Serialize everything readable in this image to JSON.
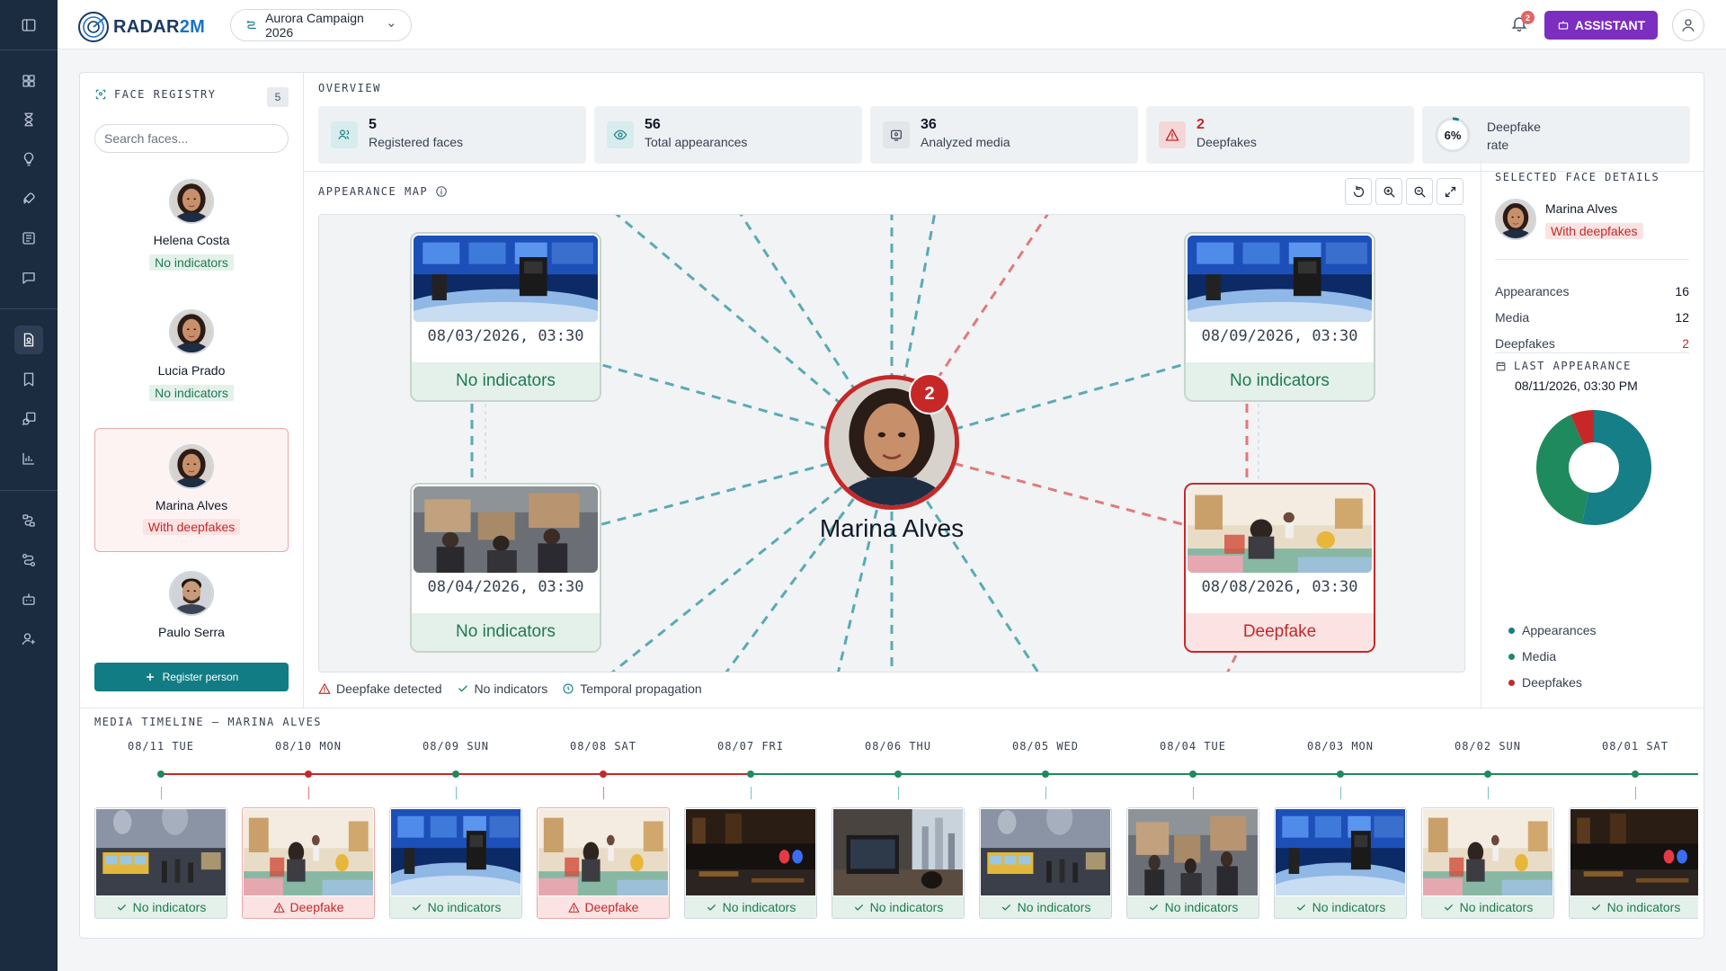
{
  "app": {
    "logo": "RADAR",
    "logo_accent": "2M",
    "campaign": "Aurora Campaign 2026",
    "notifications": "2",
    "assistant_label": "ASSISTANT"
  },
  "registry": {
    "title": "FACE REGISTRY",
    "count": "5",
    "search_placeholder": "Search faces...",
    "faces": [
      {
        "name": "Helena Costa",
        "status": "No indicators"
      },
      {
        "name": "Lucia Prado",
        "status": "No indicators"
      },
      {
        "name": "Marina Alves",
        "status": "With deepfakes"
      },
      {
        "name": "Paulo Serra",
        "status": ""
      }
    ],
    "register_label": "Register person"
  },
  "overview": {
    "title": "OVERVIEW",
    "stats": [
      {
        "value": "5",
        "label": "Registered faces"
      },
      {
        "value": "56",
        "label": "Total appearances"
      },
      {
        "value": "36",
        "label": "Analyzed media"
      },
      {
        "value": "2",
        "label": "Deepfakes"
      },
      {
        "value": "6%",
        "label": "Deepfake rate",
        "fraction": 0.06
      }
    ]
  },
  "map": {
    "title": "APPEARANCE MAP",
    "center_name": "Marina Alves",
    "center_badge": "2",
    "nodes": [
      {
        "date": "08/03/2026, 03:30",
        "status": "No indicators"
      },
      {
        "date": "08/09/2026, 03:30",
        "status": "No indicators"
      },
      {
        "date": "08/04/2026, 03:30",
        "status": "No indicators"
      },
      {
        "date": "08/08/2026, 03:30",
        "status": "Deepfake"
      }
    ],
    "legend": [
      "Deepfake detected",
      "No indicators",
      "Temporal propagation"
    ]
  },
  "details": {
    "title": "SELECTED FACE DETAILS",
    "name": "Marina Alves",
    "badge": "With deepfakes",
    "rows": [
      {
        "label": "Appearances",
        "value": "16"
      },
      {
        "label": "Media",
        "value": "12"
      },
      {
        "label": "Deepfakes",
        "value": "2"
      }
    ],
    "last_title": "LAST APPEARANCE",
    "last_value": "08/11/2026, 03:30 PM",
    "legend": [
      "Appearances",
      "Media",
      "Deepfakes"
    ]
  },
  "colors": {
    "teal": "#157e87",
    "green": "#1e8a5e",
    "red": "#c62828",
    "purple": "#7c2ec0",
    "navy": "#1b2b40"
  },
  "timeline": {
    "title": "MEDIA TIMELINE — MARINA ALVES",
    "days": [
      {
        "label": "08/11 TUE",
        "status": "No indicators"
      },
      {
        "label": "08/10 MON",
        "status": "Deepfake"
      },
      {
        "label": "08/09 SUN",
        "status": "No indicators"
      },
      {
        "label": "08/08 SAT",
        "status": "Deepfake"
      },
      {
        "label": "08/07 FRI",
        "status": "No indicators"
      },
      {
        "label": "08/06 THU",
        "status": "No indicators"
      },
      {
        "label": "08/05 WED",
        "status": "No indicators"
      },
      {
        "label": "08/04 TUE",
        "status": "No indicators"
      },
      {
        "label": "08/03 MON",
        "status": "No indicators"
      },
      {
        "label": "08/02 SUN",
        "status": "No indicators"
      },
      {
        "label": "08/01 SAT",
        "status": "No indicators"
      }
    ]
  }
}
